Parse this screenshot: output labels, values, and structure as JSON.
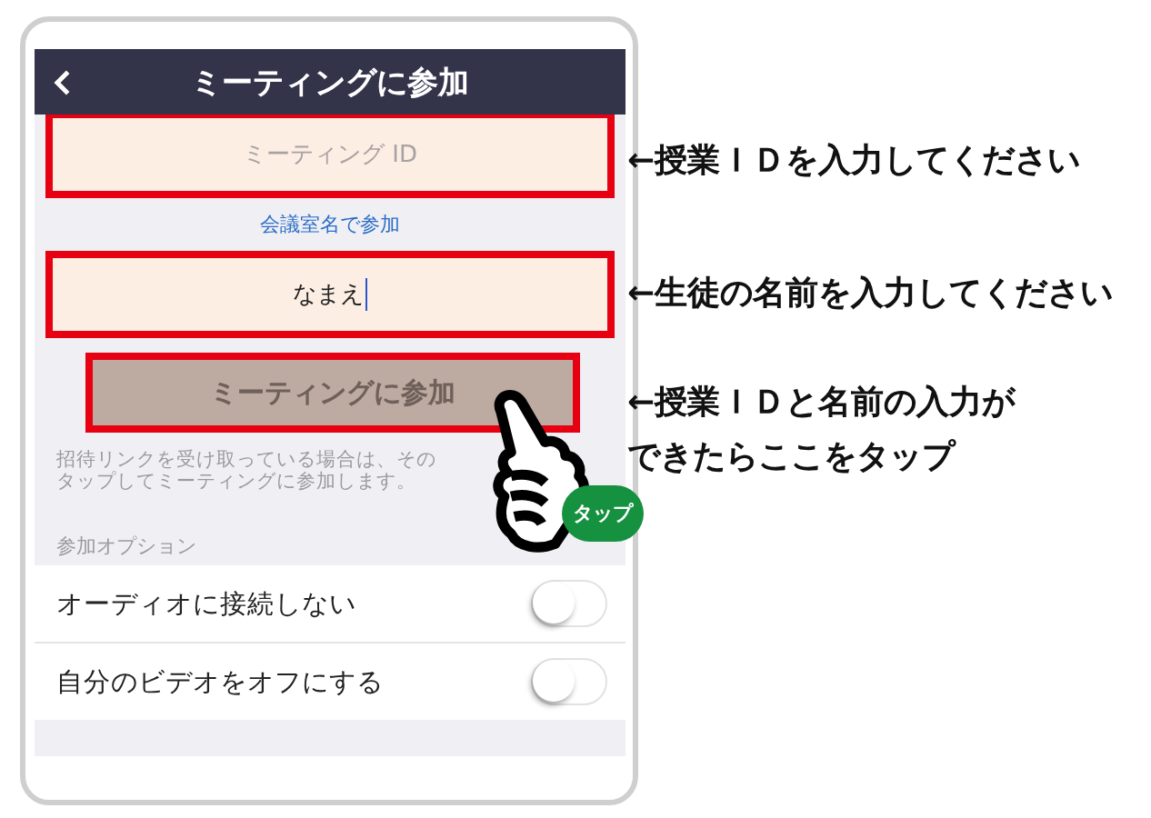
{
  "header": {
    "title": "ミーティングに参加"
  },
  "meeting_id_field": {
    "placeholder": "ミーティング ID",
    "highlighted": true
  },
  "room_name_link": "会議室名で参加",
  "name_field": {
    "value": "なまえ",
    "highlighted": true
  },
  "join_button": {
    "label": "ミーティングに参加",
    "disabled": true,
    "highlighted": true
  },
  "help_text": [
    "招待リンクを受け取っている場合は、その",
    "タップしてミーティングに参加します。"
  ],
  "options_heading": "参加オプション",
  "options": [
    {
      "label": "オーディオに接続しない",
      "on": false
    },
    {
      "label": "自分のビデオをオフにする",
      "on": false
    }
  ],
  "annotations": [
    {
      "lines": [
        "←授業ＩＤを入力してください"
      ]
    },
    {
      "lines": [
        "←生徒の名前を入力してください"
      ]
    },
    {
      "lines": [
        "←授業ＩＤと名前の入力が",
        "できたらここをタップ"
      ]
    }
  ],
  "tap_badge": "タップ"
}
